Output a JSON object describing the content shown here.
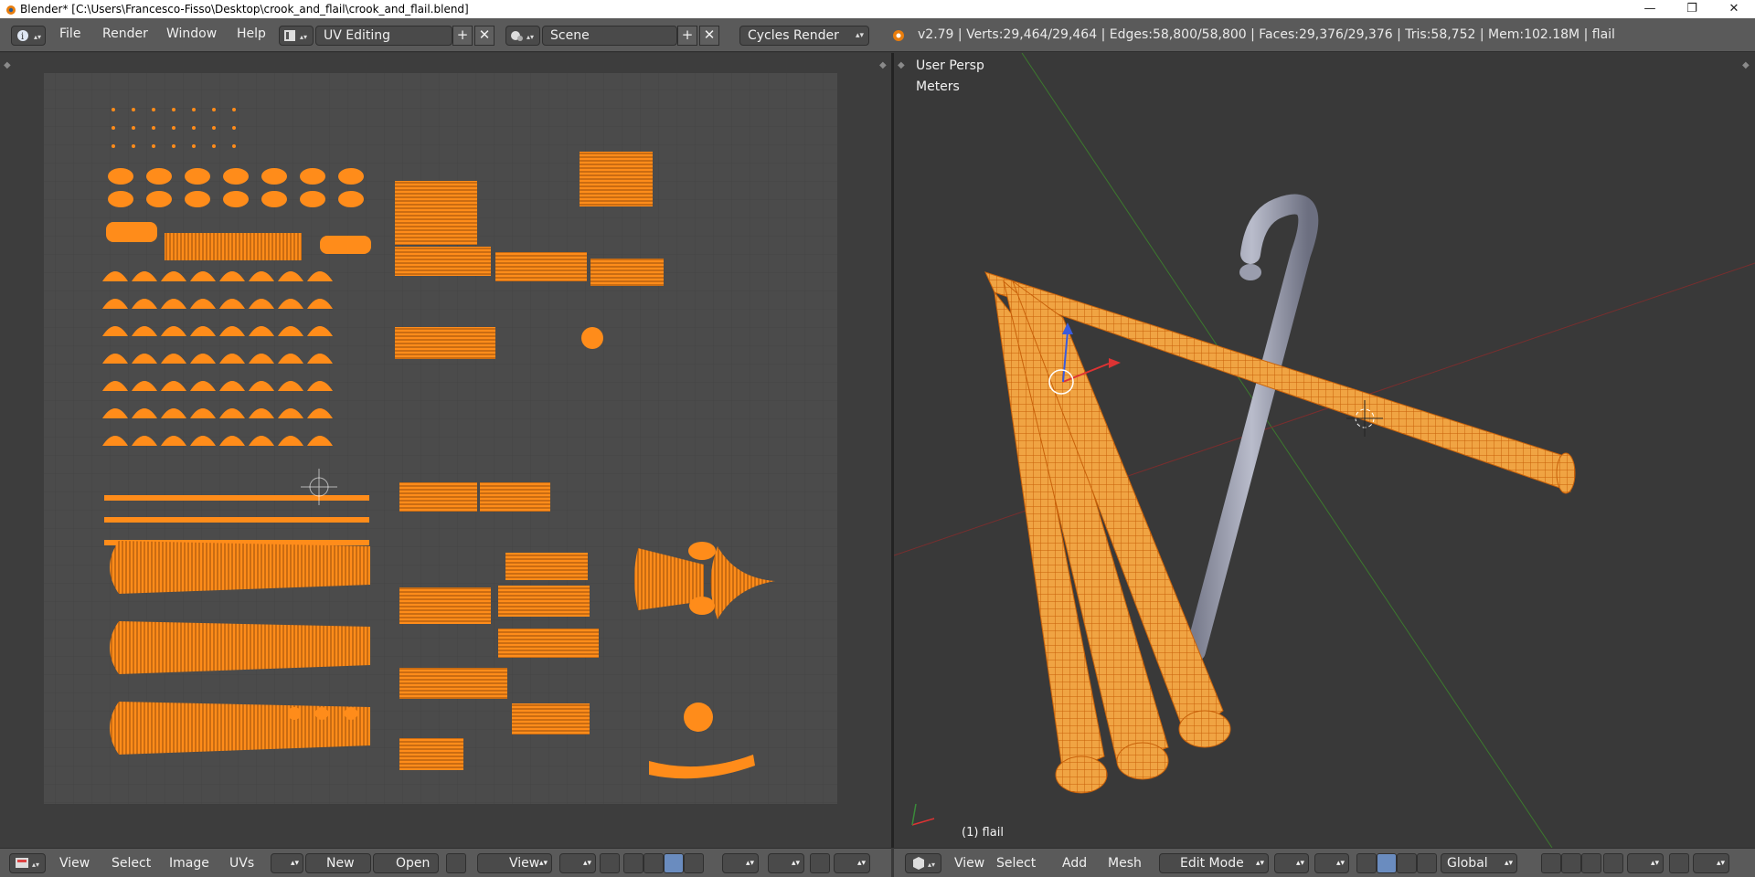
{
  "window": {
    "title": "Blender* [C:\\Users\\Francesco-Fisso\\Desktop\\crook_and_flail\\crook_and_flail.blend]",
    "minimize": "—",
    "maximize": "❐",
    "close": "✕"
  },
  "infobar": {
    "menus": [
      "File",
      "Render",
      "Window",
      "Help"
    ],
    "screen_layout": "UV Editing",
    "scene": "Scene",
    "render_engine": "Cycles Render",
    "stats": "v2.79 | Verts:29,464/29,464 | Edges:58,800/58,800 | Faces:29,376/29,376 | Tris:58,752 | Mem:102.18M | flail"
  },
  "viewport": {
    "view_name": "User Persp",
    "units": "Meters",
    "object_label": "(1) flail"
  },
  "uv_bottom": {
    "menus": [
      "View",
      "Select",
      "Image",
      "UVs"
    ],
    "new_label": "New",
    "open_label": "Open",
    "view_label": "View"
  },
  "view3d_bottom": {
    "menus": [
      "View",
      "Select",
      "Add",
      "Mesh"
    ],
    "mode": "Edit Mode",
    "orientation": "Global"
  },
  "colors": {
    "uv_orange": "#ff8c1a",
    "grid_bg": "#4b4b4b",
    "accent_blue": "#6a8cbf"
  }
}
